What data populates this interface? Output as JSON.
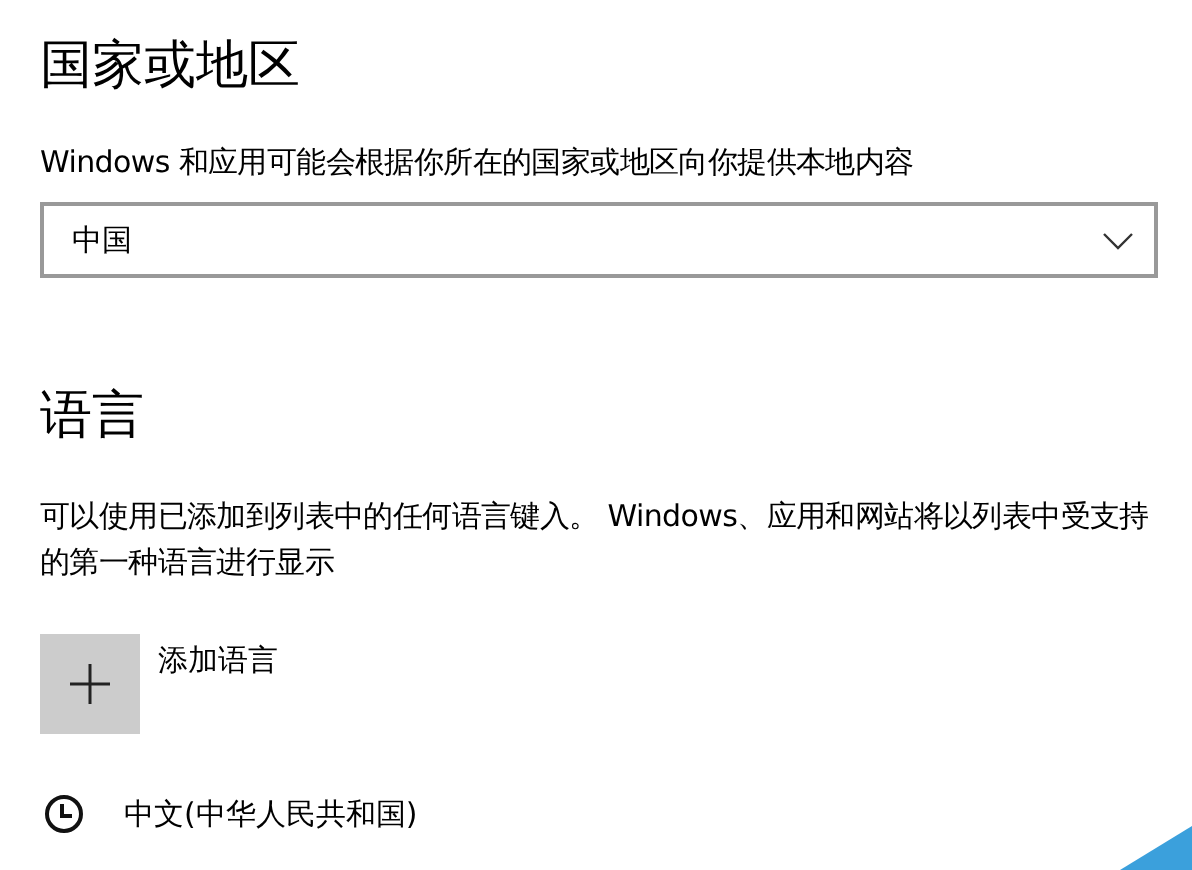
{
  "region": {
    "heading": "国家或地区",
    "description": "Windows 和应用可能会根据你所在的国家或地区向你提供本地内容",
    "dropdown": {
      "value": "中国"
    }
  },
  "language": {
    "heading": "语言",
    "description": "可以使用已添加到列表中的任何语言键入。 Windows、应用和网站将以列表中受支持的第一种语言进行显示",
    "add_button": {
      "label": "添加语言"
    },
    "items": [
      {
        "name": "中文(中华人民共和国)"
      }
    ]
  }
}
